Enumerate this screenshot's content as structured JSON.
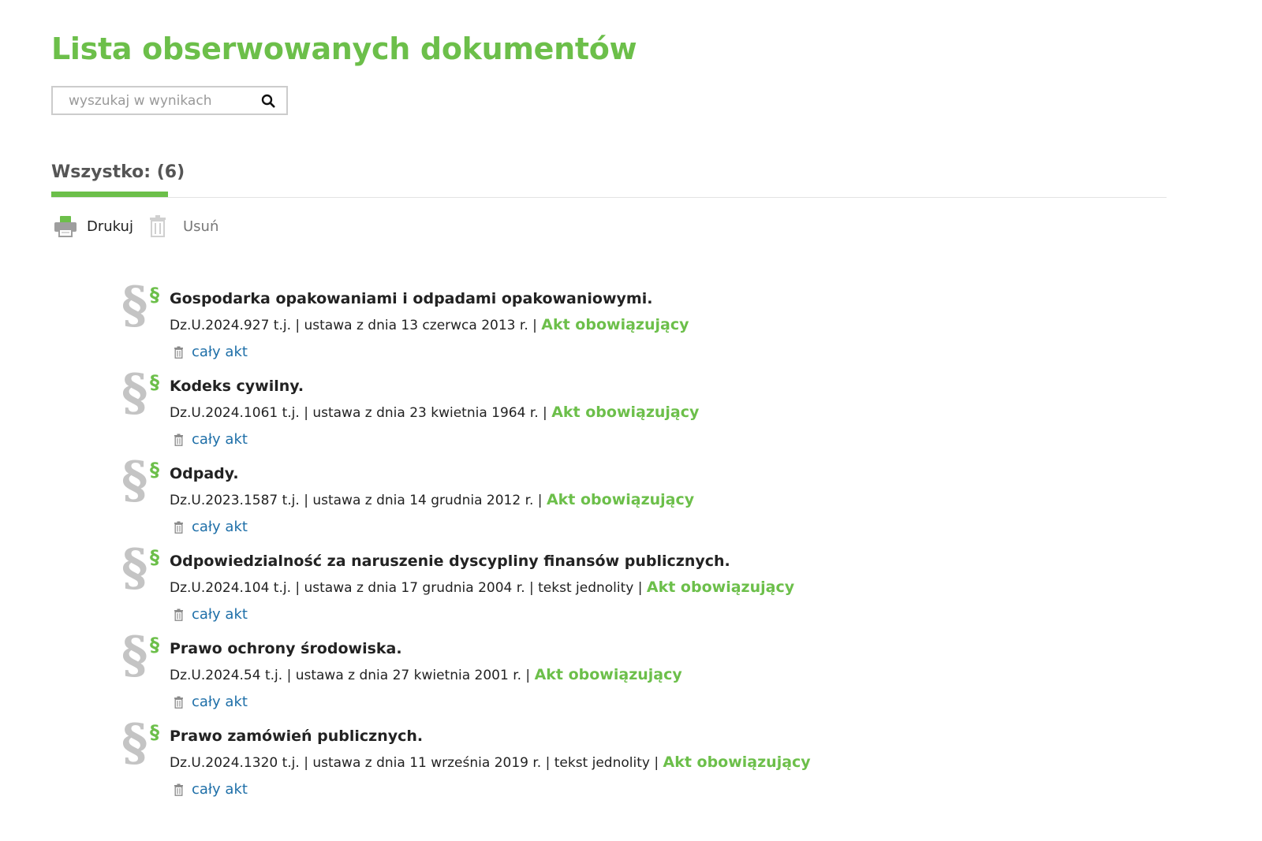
{
  "page_title": "Lista obserwowanych dokumentów",
  "search": {
    "placeholder": "wyszukaj w wynikach",
    "value": "",
    "icon": "search-icon"
  },
  "tab": {
    "label": "Wszystko: (6)",
    "active": true
  },
  "toolbar": {
    "print_label": "Drukuj",
    "print_icon": "printer-icon",
    "delete_label": "Usuń",
    "delete_icon": "trash-icon"
  },
  "colors": {
    "accent": "#6cbf4a",
    "link": "#1e6fa8",
    "text": "#222222",
    "muted": "#c4c4c4"
  },
  "documents": [
    {
      "title": "Gospodarka opakowaniami i odpadami opakowaniowymi.",
      "meta": "Dz.U.2024.927 t.j. | ustawa z dnia 13 czerwca 2013 r. | ",
      "status": "Akt obowiązujący",
      "action_label": "cały akt"
    },
    {
      "title": "Kodeks cywilny.",
      "meta": "Dz.U.2024.1061 t.j. | ustawa z dnia 23 kwietnia 1964 r. | ",
      "status": "Akt obowiązujący",
      "action_label": "cały akt"
    },
    {
      "title": "Odpady.",
      "meta": "Dz.U.2023.1587 t.j. | ustawa z dnia 14 grudnia 2012 r. | ",
      "status": "Akt obowiązujący",
      "action_label": "cały akt"
    },
    {
      "title": "Odpowiedzialność za naruszenie dyscypliny finansów publicznych.",
      "meta": "Dz.U.2024.104 t.j. | ustawa z dnia 17 grudnia 2004 r. | tekst jednolity | ",
      "status": "Akt obowiązujący",
      "action_label": "cały akt"
    },
    {
      "title": "Prawo ochrony środowiska.",
      "meta": "Dz.U.2024.54 t.j. | ustawa z dnia 27 kwietnia 2001 r. | ",
      "status": "Akt obowiązujący",
      "action_label": "cały akt"
    },
    {
      "title": "Prawo zamówień publicznych.",
      "meta": "Dz.U.2024.1320 t.j. | ustawa z dnia 11 września 2019 r. | tekst jednolity | ",
      "status": "Akt obowiązujący",
      "action_label": "cały akt"
    }
  ]
}
